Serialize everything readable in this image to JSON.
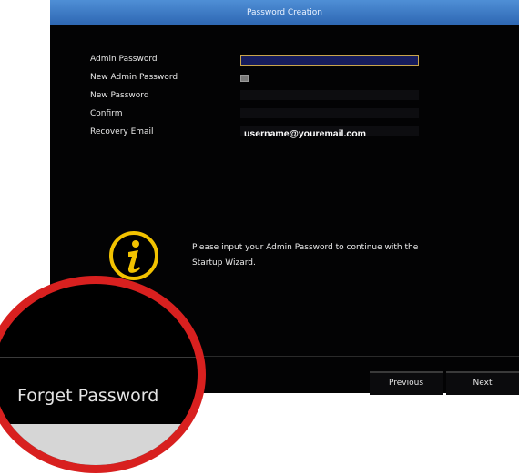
{
  "window": {
    "title": "Password Creation"
  },
  "form": {
    "admin_password_label": "Admin Password",
    "new_admin_password_label": "New Admin Password",
    "new_password_label": "New Password",
    "confirm_label": "Confirm",
    "recovery_email_label": "Recovery Email",
    "recovery_email_value": "username@youremail.com",
    "new_admin_password_checked": false
  },
  "info": {
    "icon": "info-icon",
    "line1": "Please input your Admin Password to continue with the",
    "line2": "Startup Wizard."
  },
  "footer": {
    "previous_label": "Previous",
    "next_label": "Next"
  },
  "magnifier": {
    "label": "Forget Password"
  },
  "colors": {
    "title_bar": "#3d7cc9",
    "active_field_border": "#c9a54a",
    "magnifier_ring": "#d8201f",
    "info_icon": "#f2c200"
  }
}
